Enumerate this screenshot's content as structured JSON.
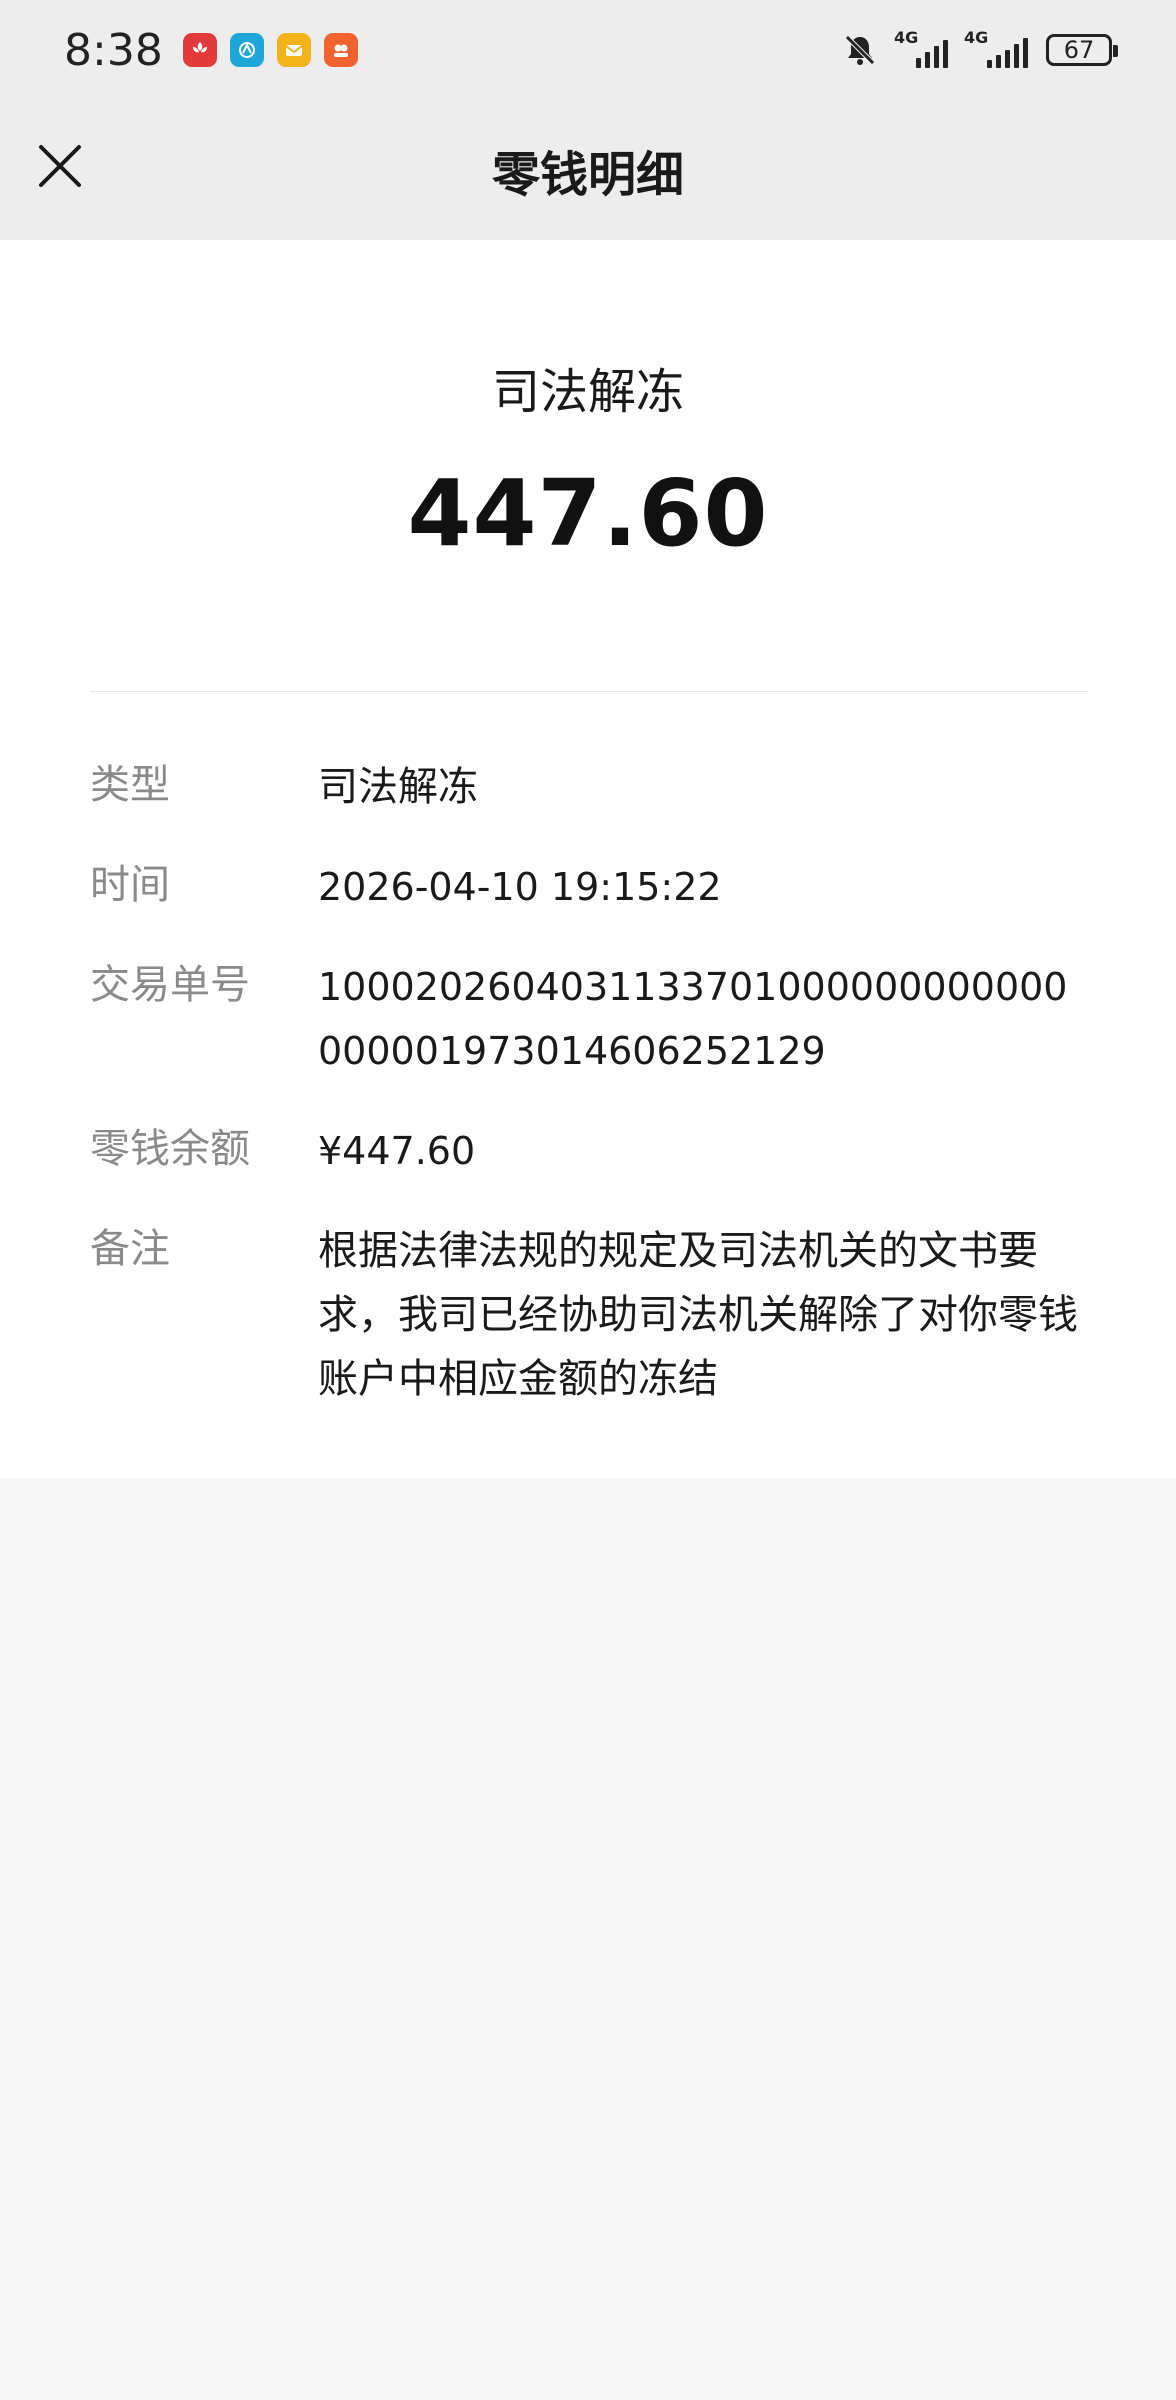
{
  "status_bar": {
    "time": "8:38",
    "network_1": "4G",
    "network_2": "4G",
    "battery": "67",
    "app_icons": [
      {
        "name": "huawei-icon",
        "color": "#e2393b"
      },
      {
        "name": "browser-icon",
        "color": "#1fa6d9"
      },
      {
        "name": "mail-icon",
        "color": "#f2b21a"
      },
      {
        "name": "app-icon",
        "color": "#f0622e"
      }
    ]
  },
  "nav": {
    "title": "零钱明细",
    "close_icon": "close-icon"
  },
  "summary": {
    "type_label": "司法解冻",
    "amount": "447.60"
  },
  "details": [
    {
      "label": "类型",
      "value": "司法解冻"
    },
    {
      "label": "时间",
      "value": "2026-04-10 19:15:22"
    },
    {
      "label": "交易单号",
      "value": "1000202604031133701000000000000000001973014606252129"
    },
    {
      "label": "零钱余额",
      "value": "¥447.60"
    },
    {
      "label": "备注",
      "value": "根据法律法规的规定及司法机关的文书要求，我司已经协助司法机关解除了对你零钱账户中相应金额的冻结"
    }
  ],
  "colors": {
    "header_bg": "#ededed",
    "card_bg": "#ffffff",
    "page_bg": "#f6f6f6",
    "label_gray": "#8a8a8a"
  }
}
